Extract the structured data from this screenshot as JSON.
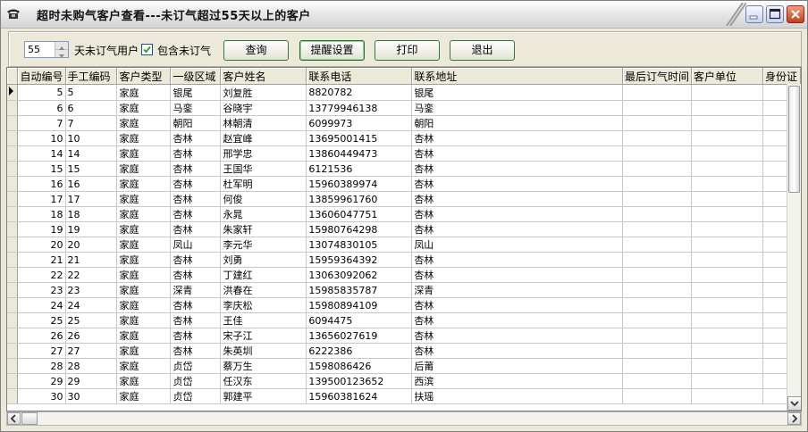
{
  "window": {
    "title": "超时未购气客户查看---未订气超过55天以上的客户"
  },
  "toolbar": {
    "days_value": "55",
    "days_label": "天未订气用户",
    "include_label": "包含未订气",
    "include_checked": true,
    "query_label": "查询",
    "remind_label": "提醒设置",
    "print_label": "打印",
    "exit_label": "退出"
  },
  "table": {
    "columns": [
      "自动编号",
      "手工编码",
      "客户类型",
      "一级区域",
      "客户姓名",
      "联系电话",
      "联系地址",
      "最后订气时间",
      "客户单位",
      "身份证"
    ],
    "rows": [
      [
        "5",
        "5",
        "家庭",
        "银尾",
        "刘复胜",
        "8820782",
        "银尾",
        "",
        ""
      ],
      [
        "6",
        "6",
        "家庭",
        "马銮",
        "谷晓宇",
        "13779946138",
        "马銮",
        "",
        ""
      ],
      [
        "7",
        "7",
        "家庭",
        "朝阳",
        "林朝清",
        "6099973",
        "朝阳",
        "",
        ""
      ],
      [
        "10",
        "10",
        "家庭",
        "杏林",
        "赵宜峰",
        "13695001415",
        "杏林",
        "",
        ""
      ],
      [
        "14",
        "14",
        "家庭",
        "杏林",
        "邢学忠",
        "13860449473",
        "杏林",
        "",
        ""
      ],
      [
        "15",
        "15",
        "家庭",
        "杏林",
        "王国华",
        "6121536",
        "杏林",
        "",
        ""
      ],
      [
        "16",
        "16",
        "家庭",
        "杏林",
        "杜军明",
        "15960389974",
        "杏林",
        "",
        ""
      ],
      [
        "17",
        "17",
        "家庭",
        "杏林",
        "何俊",
        "13859961760",
        "杏林",
        "",
        ""
      ],
      [
        "18",
        "18",
        "家庭",
        "杏林",
        "永晁",
        "13606047751",
        "杏林",
        "",
        ""
      ],
      [
        "19",
        "19",
        "家庭",
        "杏林",
        "朱家轩",
        "15980764298",
        "杏林",
        "",
        ""
      ],
      [
        "20",
        "20",
        "家庭",
        "凤山",
        "李元华",
        "13074830105",
        "凤山",
        "",
        ""
      ],
      [
        "21",
        "21",
        "家庭",
        "杏林",
        "刘勇",
        "15959364392",
        "杏林",
        "",
        ""
      ],
      [
        "22",
        "22",
        "家庭",
        "杏林",
        "丁建红",
        "13063092062",
        "杏林",
        "",
        ""
      ],
      [
        "23",
        "23",
        "家庭",
        "深青",
        "洪春在",
        "15985835787",
        "深青",
        "",
        ""
      ],
      [
        "24",
        "24",
        "家庭",
        "杏林",
        "李庆松",
        "15980894109",
        "杏林",
        "",
        ""
      ],
      [
        "25",
        "25",
        "家庭",
        "杏林",
        "王佳",
        "6094475",
        "杏林",
        "",
        ""
      ],
      [
        "26",
        "26",
        "家庭",
        "杏林",
        "宋子江",
        "13656027619",
        "杏林",
        "",
        ""
      ],
      [
        "27",
        "27",
        "家庭",
        "杏林",
        "朱英圳",
        "6222386",
        "杏林",
        "",
        ""
      ],
      [
        "28",
        "28",
        "家庭",
        "贞岱",
        "蔡万生",
        "1598086426",
        "后莆",
        "",
        ""
      ],
      [
        "29",
        "29",
        "家庭",
        "贞岱",
        "任汉东",
        "13950012365​2",
        "西滨",
        "",
        ""
      ],
      [
        "30",
        "30",
        "家庭",
        "贞岱",
        "郭建平",
        "15960381624",
        "扶瑶",
        "",
        ""
      ]
    ]
  }
}
